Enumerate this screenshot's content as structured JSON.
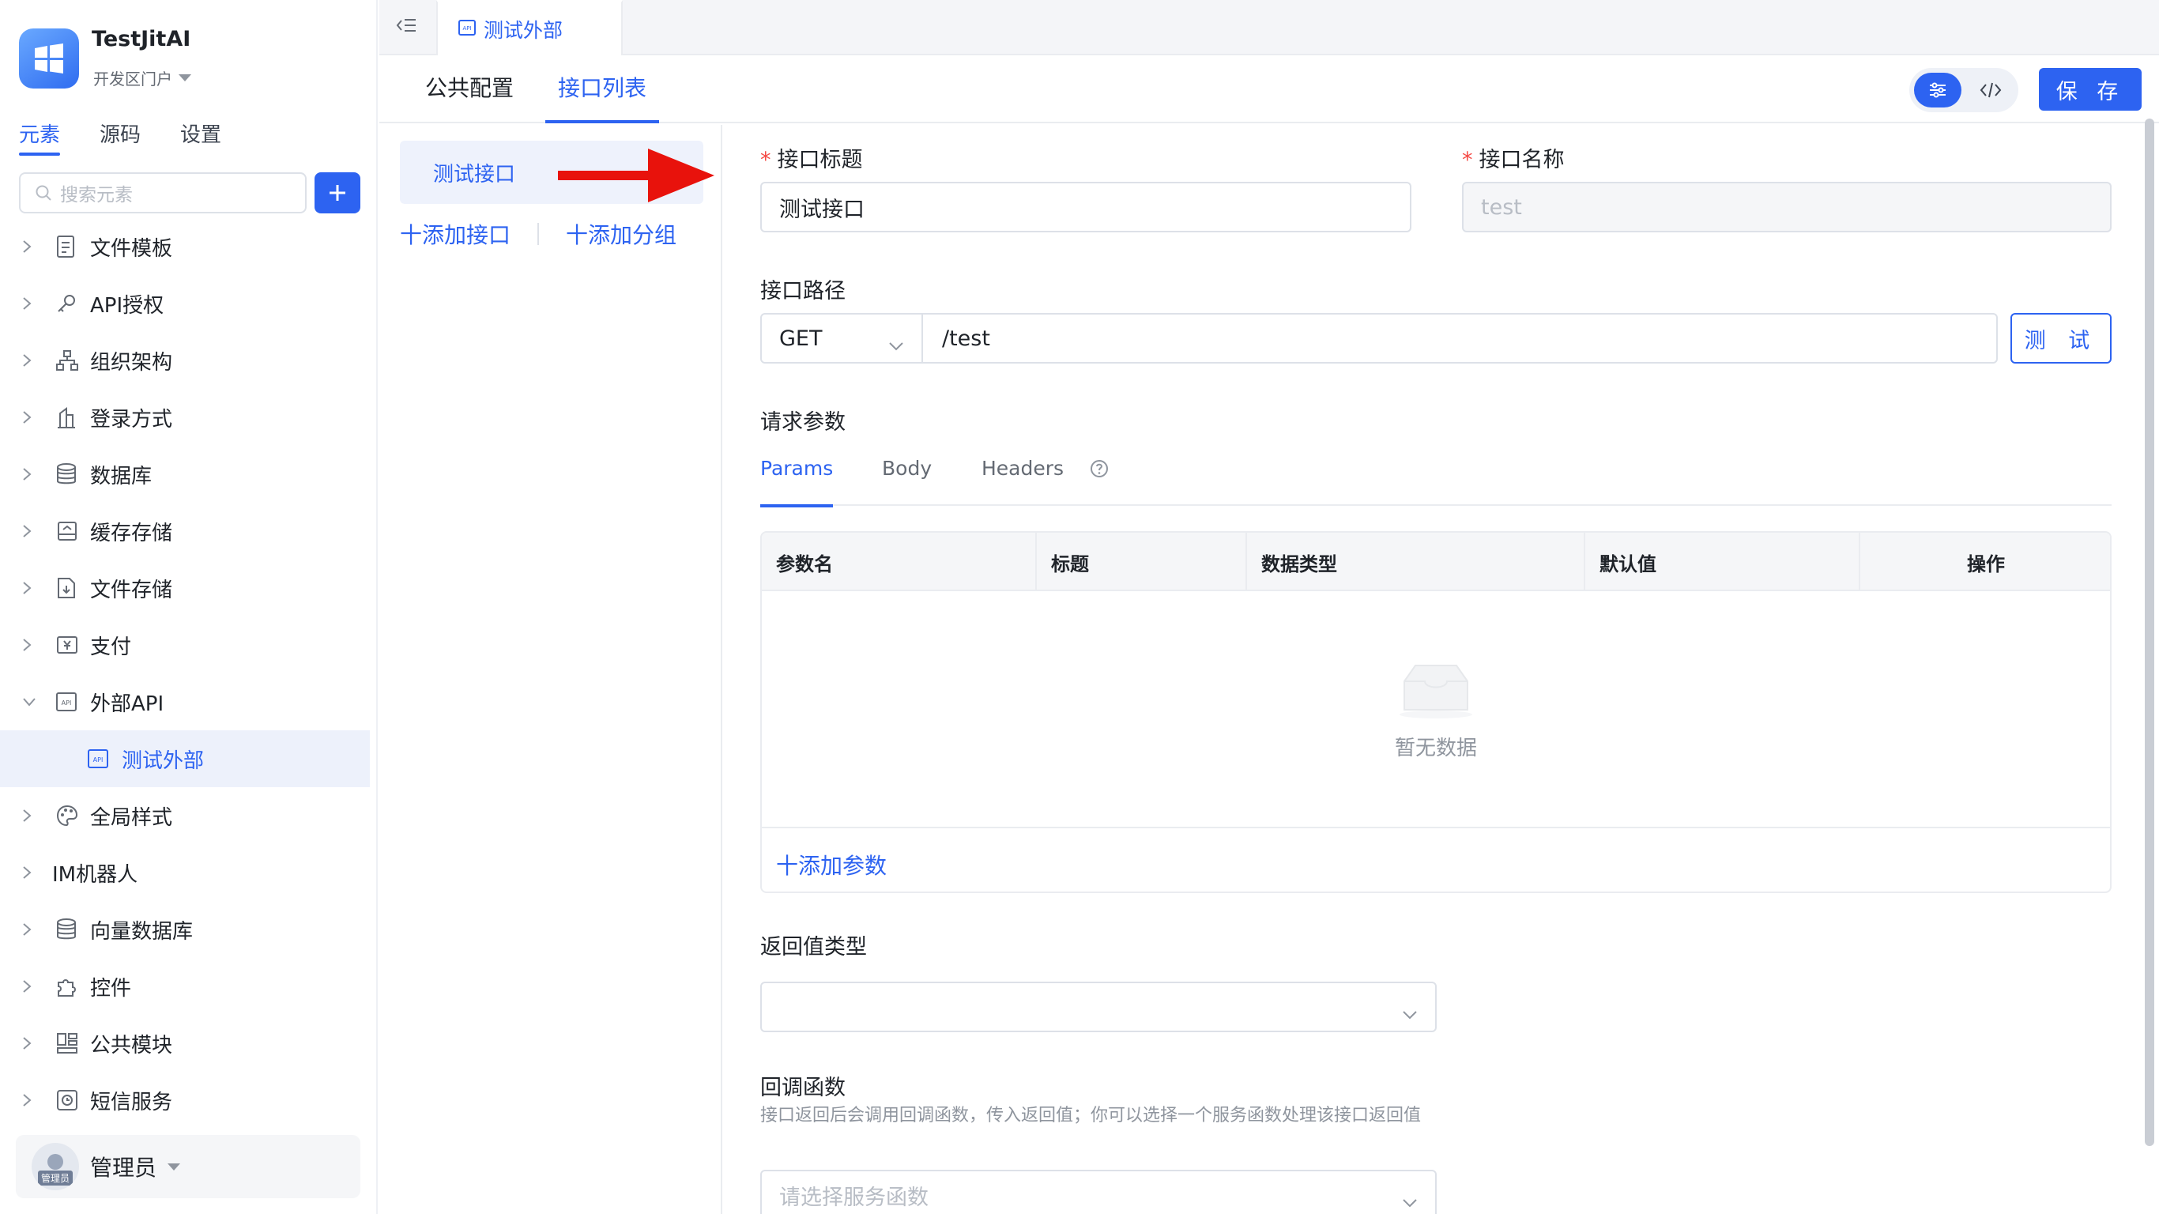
{
  "app": {
    "name": "TestJitAI",
    "portal": "开发区门户"
  },
  "sidebar": {
    "tabs": [
      {
        "label": "元素",
        "active": true
      },
      {
        "label": "源码",
        "active": false
      },
      {
        "label": "设置",
        "active": false
      }
    ],
    "search_placeholder": "搜索元素",
    "items": [
      {
        "label": "文件模板",
        "icon": "file-template-icon"
      },
      {
        "label": "API授权",
        "icon": "key-icon"
      },
      {
        "label": "组织架构",
        "icon": "org-chart-icon"
      },
      {
        "label": "登录方式",
        "icon": "building-icon"
      },
      {
        "label": "数据库",
        "icon": "database-icon"
      },
      {
        "label": "缓存存储",
        "icon": "cache-icon"
      },
      {
        "label": "文件存储",
        "icon": "file-storage-icon"
      },
      {
        "label": "支付",
        "icon": "payment-icon"
      },
      {
        "label": "外部API",
        "icon": "api-icon",
        "expanded": true
      },
      {
        "label": "测试外部",
        "icon": "api-icon",
        "child": true,
        "selected": true
      },
      {
        "label": "全局样式",
        "icon": "palette-icon"
      },
      {
        "label": "IM机器人",
        "icon": ""
      },
      {
        "label": "向量数据库",
        "icon": "database-icon"
      },
      {
        "label": "控件",
        "icon": "puzzle-icon"
      },
      {
        "label": "公共模块",
        "icon": "module-icon"
      },
      {
        "label": "短信服务",
        "icon": "sms-icon"
      }
    ],
    "user": {
      "name": "管理员",
      "badge": "管理员"
    }
  },
  "topbar": {
    "open_tab": "测试外部"
  },
  "subtabs": [
    {
      "label": "公共配置",
      "active": false
    },
    {
      "label": "接口列表",
      "active": true
    }
  ],
  "toolbar": {
    "save_label": "保 存"
  },
  "interface_list": {
    "items": [
      "测试接口"
    ],
    "add_interface": "十添加接口",
    "add_group": "十添加分组"
  },
  "form": {
    "title_label": "接口标题",
    "title_value": "测试接口",
    "name_label": "接口名称",
    "name_value": "test",
    "path_label": "接口路径",
    "method": "GET",
    "path": "/test",
    "test_label": "测 试",
    "params_label": "请求参数",
    "param_tabs": [
      {
        "label": "Params",
        "active": true
      },
      {
        "label": "Body",
        "active": false
      },
      {
        "label": "Headers",
        "active": false
      }
    ],
    "table_headers": [
      "参数名",
      "标题",
      "数据类型",
      "默认值",
      "操作"
    ],
    "empty_text": "暂无数据",
    "add_param": "十添加参数",
    "return_type_label": "返回值类型",
    "return_type_value": "",
    "callback_label": "回调函数",
    "callback_help": "接口返回后会调用回调函数，传入返回值；你可以选择一个服务函数处理该接口返回值",
    "callback_placeholder": "请选择服务函数"
  },
  "colors": {
    "accent": "#2d63f1",
    "required": "#f54a45",
    "annotation_arrow": "#e8120c"
  }
}
